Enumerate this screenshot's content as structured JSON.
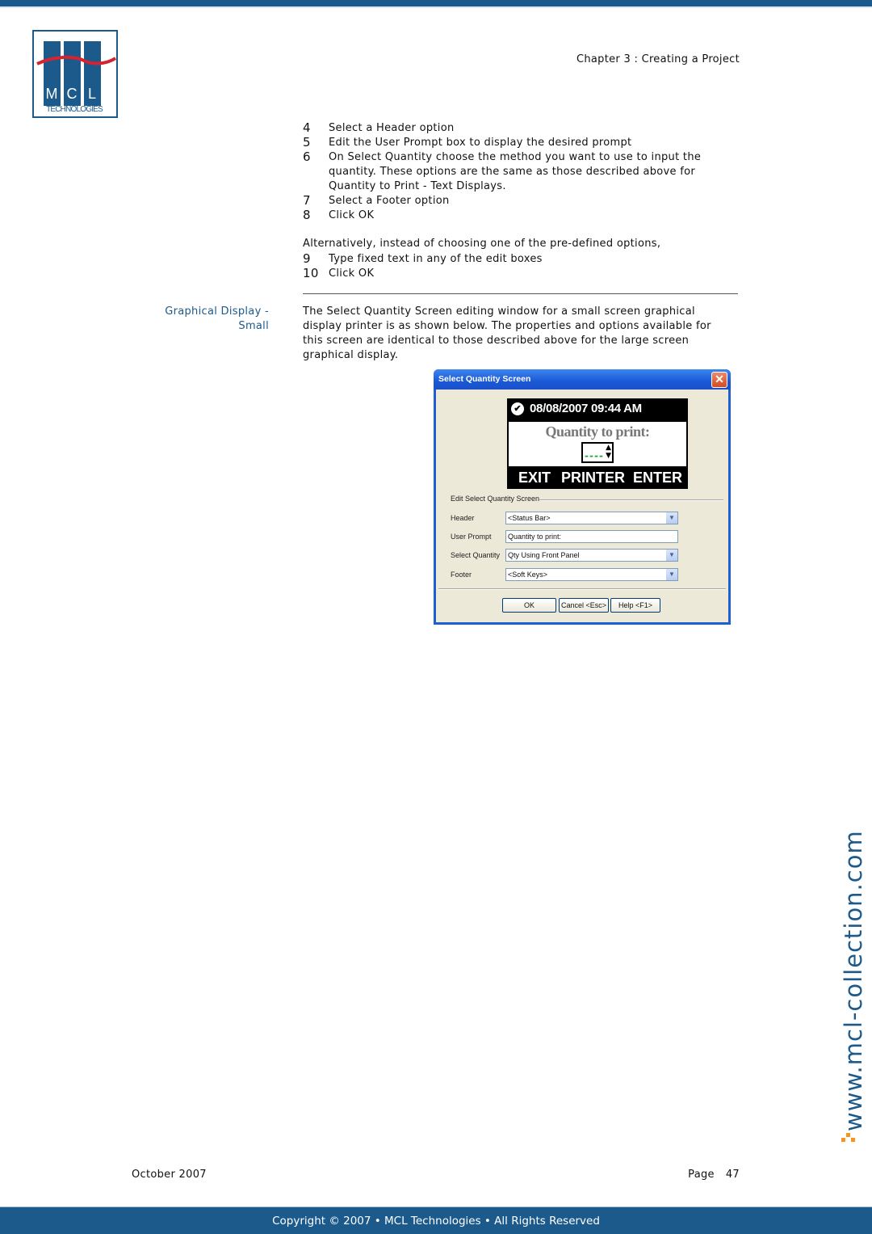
{
  "header": {
    "chapter": "Chapter 3 : Creating a Project",
    "logo": {
      "letters": [
        "M",
        "C",
        "L"
      ],
      "subtitle": "TECHNOLOGIES",
      "brand_color": "#1c5a8c",
      "wave_color": "#d7232f"
    }
  },
  "steps_a": [
    {
      "num": "4",
      "text": "Select a Header option"
    },
    {
      "num": "5",
      "text": "Edit the User Prompt box to display the desired prompt"
    },
    {
      "num": "6",
      "text": "On Select Quantity choose the method you want to use to input the quantity. These options are the same as those described above for Quantity to Print - Text Displays."
    },
    {
      "num": "7",
      "text": "Select a Footer option"
    },
    {
      "num": "8",
      "text": "Click OK"
    }
  ],
  "alternative_intro": "Alternatively, instead of choosing one of the pre-defined options,",
  "steps_b": [
    {
      "num": "9",
      "text": "Type fixed text in any of the edit boxes"
    },
    {
      "num": "10",
      "text": "Click OK"
    }
  ],
  "section": {
    "heading_line1": "Graphical Display -",
    "heading_line2": "Small",
    "body": "The Select Quantity Screen editing window for a small screen graphical display printer is as shown below. The properties and options available for this screen are identical to those described above for the large screen graphical display."
  },
  "dialog": {
    "title": "Select Quantity Screen",
    "close_glyph": "✕",
    "preview": {
      "status_icon": "✔",
      "datetime": "08/08/2007 09:44 AM",
      "prompt": "Quantity to print:",
      "dashes": "----",
      "spinner": "▲▼",
      "soft_keys": [
        "EXIT",
        "PRINTER",
        "ENTER"
      ]
    },
    "group_label": "Edit Select Quantity Screen",
    "fields": [
      {
        "label": "Header",
        "value": "<Status Bar>",
        "type": "dropdown"
      },
      {
        "label": "User Prompt",
        "value": "Quantity to print:",
        "type": "text"
      },
      {
        "label": "Select Quantity",
        "value": "Qty Using Front Panel",
        "type": "dropdown"
      },
      {
        "label": "Footer",
        "value": "<Soft Keys>",
        "type": "dropdown"
      }
    ],
    "dropdown_glyph": "⌄",
    "buttons": {
      "ok": "OK",
      "cancel": "Cancel <Esc>",
      "help": "Help <F1>"
    }
  },
  "watermark": "www.mcl-collection.com",
  "footer": {
    "date": "October 2007",
    "page_label": "Page",
    "page_number": "47",
    "copyright": "Copyright © 2007 • MCL Technologies • All Rights Reserved"
  }
}
